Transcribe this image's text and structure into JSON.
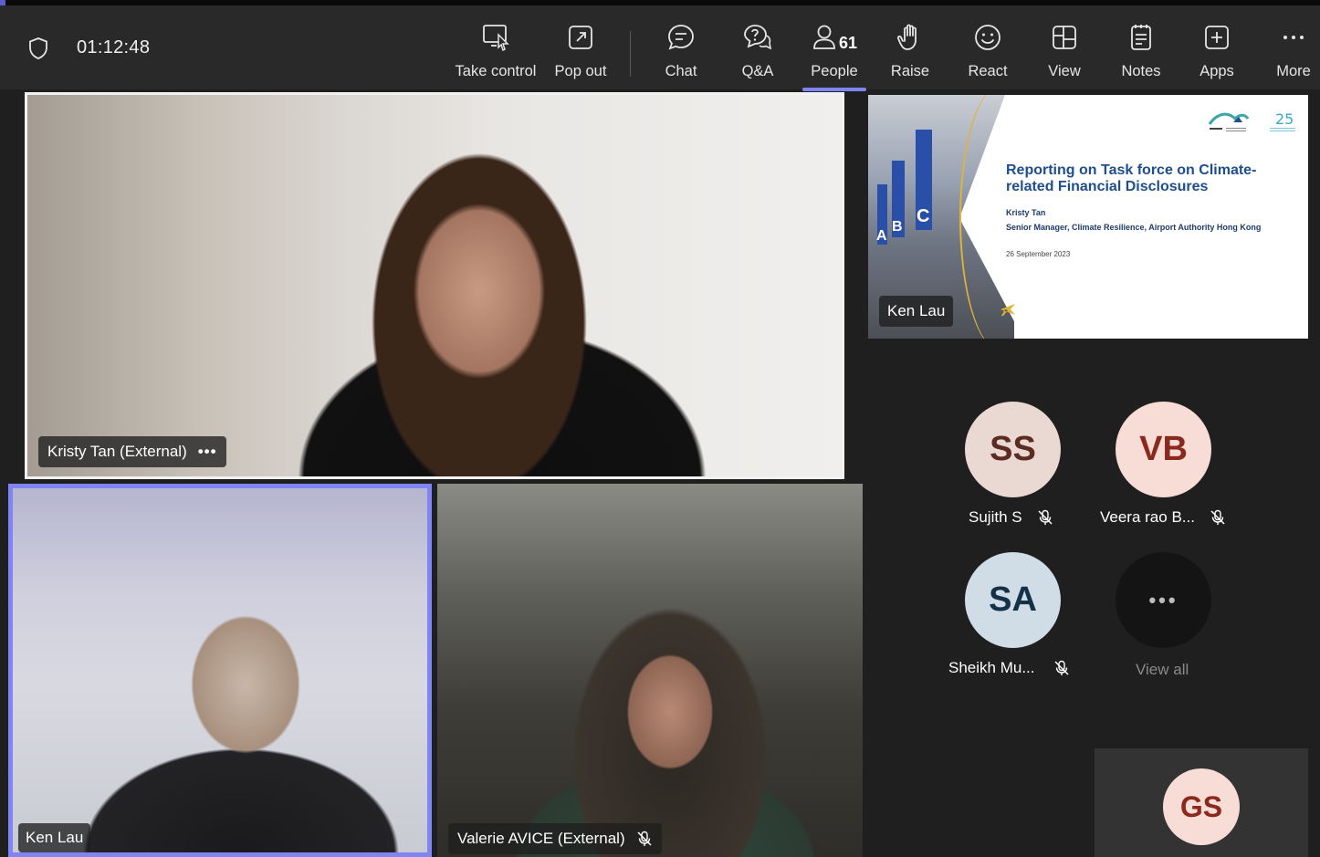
{
  "meeting": {
    "timer": "01:12:48"
  },
  "toolbar": {
    "take_control": "Take control",
    "pop_out": "Pop out",
    "chat": "Chat",
    "qa": "Q&A",
    "people": "People",
    "people_count": "61",
    "raise": "Raise",
    "react": "React",
    "view": "View",
    "notes": "Notes",
    "apps": "Apps",
    "more": "More"
  },
  "tiles": {
    "kristy": {
      "name": "Kristy Tan (External)",
      "more": "•••"
    },
    "ken": {
      "name": "Ken Lau"
    },
    "valerie": {
      "name": "Valerie AVICE (External)"
    },
    "shared": {
      "presenter": "Ken Lau"
    }
  },
  "slide": {
    "title": "Reporting on Task force on Climate-related Financial Disclosures",
    "author": "Kristy Tan",
    "role": "Senior Manager, Climate Resilience, Airport Authority Hong Kong",
    "date": "26 September 2023",
    "letters": [
      "A",
      "B",
      "C"
    ]
  },
  "participants": [
    {
      "initials": "SS",
      "name": "Sujith S",
      "color": "#ead9d3",
      "text_color": "#5b2c22"
    },
    {
      "initials": "VB",
      "name": "Veera rao B...",
      "color": "#f8dcd6",
      "text_color": "#8a2a1e"
    },
    {
      "initials": "SA",
      "name": "Sheikh Mu...",
      "color": "#d0dde6",
      "text_color": "#143247"
    },
    {
      "initials": "GS",
      "name": "",
      "color": "#f8dcd6",
      "text_color": "#8a2a1e"
    }
  ],
  "view_all": {
    "dots": "•••",
    "label": "View all"
  }
}
